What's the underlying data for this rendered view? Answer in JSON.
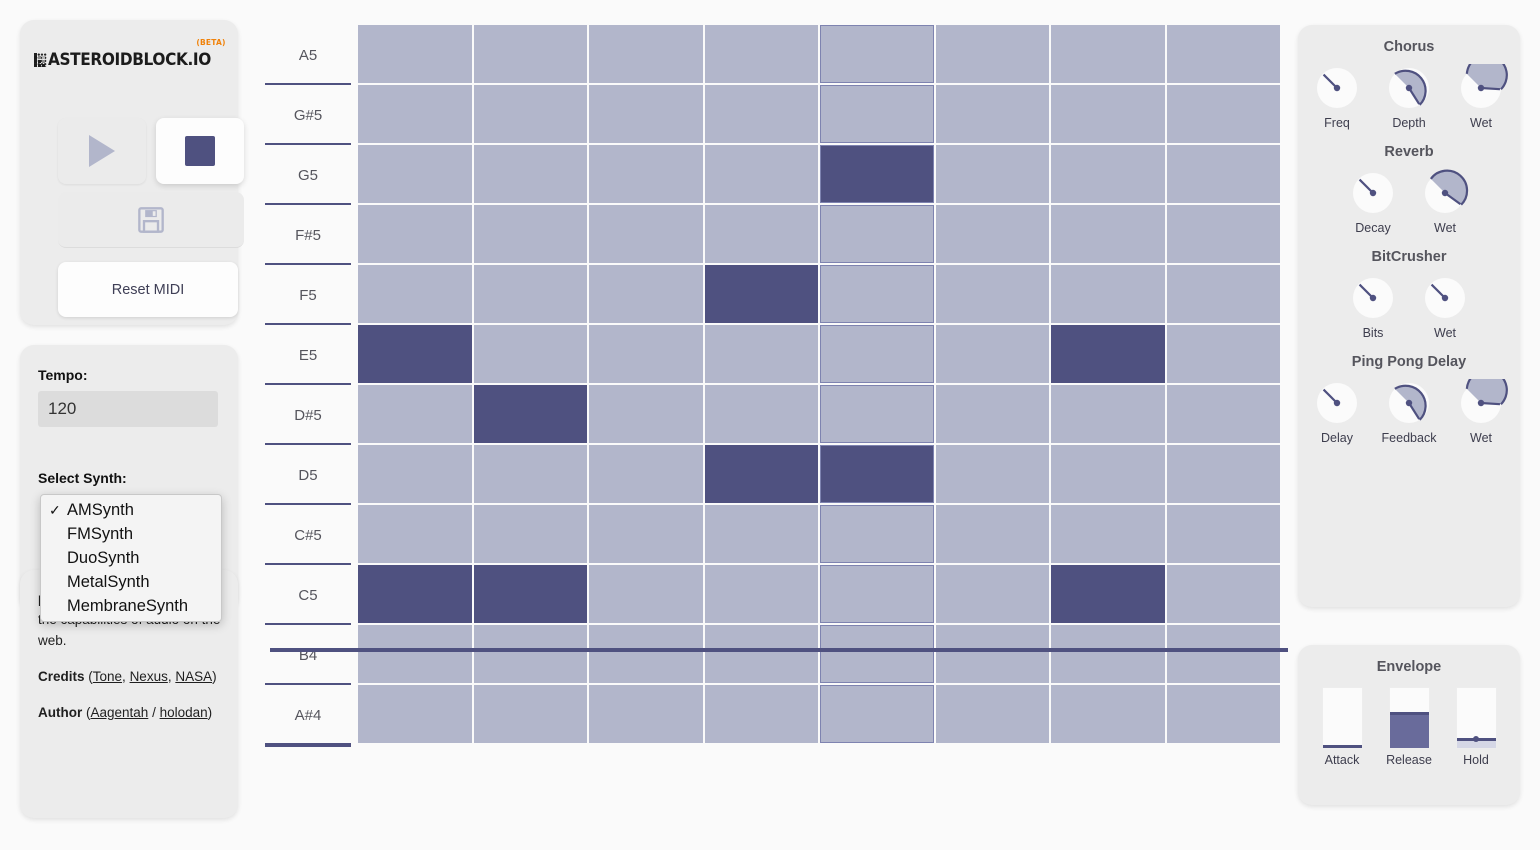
{
  "app": {
    "logo_text": "ASTEROIDBLOCK.IO",
    "logo_beta": "(BETA)",
    "brand_orange": "#f0820a",
    "accent": "#4f5180",
    "cell_off": "#b2b6cb",
    "panel_bg": "#ececec",
    "page_bg": "#fafafa"
  },
  "transport": {
    "play_label": "play-icon",
    "stop_label": "stop-icon",
    "save_label": "save-icon",
    "reset_label": "Reset MIDI",
    "play_active": false,
    "stop_active": true
  },
  "settings": {
    "tempo_label": "Tempo:",
    "tempo_value": "120",
    "tempo_placeholder": "120",
    "synth_label": "Select Synth:",
    "synth_selected": "AMSynth",
    "synth_options": [
      {
        "label": "AMSynth",
        "checked": true
      },
      {
        "label": "FMSynth",
        "checked": false
      },
      {
        "label": "DuoSynth",
        "checked": false
      },
      {
        "label": "MetalSynth",
        "checked": false
      },
      {
        "label": "MembraneSynth",
        "checked": false
      }
    ]
  },
  "about": {
    "paragraph_visible": "personal challenge to address the capabilities of audio on the web.",
    "credits_label": "Credits",
    "credits_links": [
      "Tone",
      "Nexus",
      "NASA"
    ],
    "author_label": "Author",
    "author_links": [
      "Aagentah",
      "holodan"
    ]
  },
  "sequencer": {
    "columns": 8,
    "playhead_column": 4,
    "rows": [
      {
        "note": "A5",
        "steps": [
          0,
          0,
          0,
          0,
          0,
          0,
          0,
          0
        ]
      },
      {
        "note": "G#5",
        "steps": [
          0,
          0,
          0,
          0,
          0,
          0,
          0,
          0
        ]
      },
      {
        "note": "G5",
        "steps": [
          0,
          0,
          0,
          0,
          1,
          0,
          0,
          0
        ]
      },
      {
        "note": "F#5",
        "steps": [
          0,
          0,
          0,
          0,
          0,
          0,
          0,
          0
        ]
      },
      {
        "note": "F5",
        "steps": [
          0,
          0,
          0,
          1,
          0,
          0,
          0,
          0
        ]
      },
      {
        "note": "E5",
        "steps": [
          1,
          0,
          0,
          0,
          0,
          0,
          1,
          0
        ]
      },
      {
        "note": "D#5",
        "steps": [
          0,
          1,
          0,
          0,
          0,
          0,
          0,
          0
        ]
      },
      {
        "note": "D5",
        "steps": [
          0,
          0,
          0,
          1,
          1,
          0,
          0,
          0
        ]
      },
      {
        "note": "C#5",
        "steps": [
          0,
          0,
          0,
          0,
          0,
          0,
          0,
          0
        ]
      },
      {
        "note": "C5",
        "steps": [
          1,
          1,
          0,
          0,
          0,
          0,
          1,
          0
        ]
      },
      {
        "note": "B4",
        "steps": [
          0,
          0,
          0,
          0,
          0,
          0,
          0,
          0
        ]
      },
      {
        "note": "A#4",
        "steps": [
          0,
          0,
          0,
          0,
          0,
          0,
          0,
          0
        ]
      }
    ]
  },
  "effects": [
    {
      "title": "Chorus",
      "knobs": [
        {
          "label": "Freq",
          "value": 0.0
        },
        {
          "label": "Depth",
          "value": 0.62
        },
        {
          "label": "Wet",
          "value": 0.82
        }
      ]
    },
    {
      "title": "Reverb",
      "knobs": [
        {
          "label": "Decay",
          "value": 0.0
        },
        {
          "label": "Wet",
          "value": 0.7
        }
      ]
    },
    {
      "title": "BitCrusher",
      "knobs": [
        {
          "label": "Bits",
          "value": 0.0
        },
        {
          "label": "Wet",
          "value": 0.0
        }
      ]
    },
    {
      "title": "Ping Pong Delay",
      "knobs": [
        {
          "label": "Delay",
          "value": 0.0
        },
        {
          "label": "Feedback",
          "value": 0.62
        },
        {
          "label": "Wet",
          "value": 0.82
        }
      ]
    }
  ],
  "envelope": {
    "title": "Envelope",
    "sliders": [
      {
        "label": "Attack",
        "value": 0.03
      },
      {
        "label": "Release",
        "value": 0.55
      },
      {
        "label": "Hold",
        "value": 0.12
      }
    ]
  }
}
